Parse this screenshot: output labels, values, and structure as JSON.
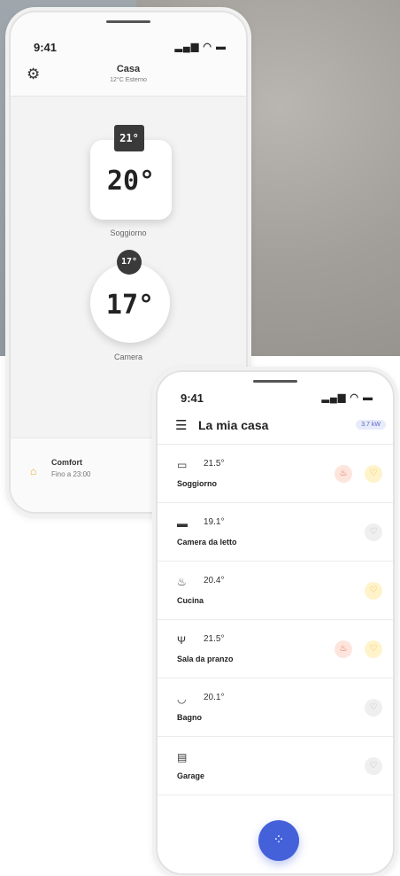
{
  "phone1": {
    "status": {
      "time": "9:41",
      "icons": "▂▄▆ ◠ ▬"
    },
    "header": {
      "title": "Casa",
      "subtitle": "12°C Esterno",
      "settings_icon": "gear-icon"
    },
    "thermostats": [
      {
        "room": "Soggiorno",
        "setpoint": "21°",
        "temperature": "20°",
        "shape": "square"
      },
      {
        "room": "Camera",
        "setpoint": "17°",
        "temperature": "17°",
        "shape": "round"
      }
    ],
    "footer": {
      "mode": "Comfort",
      "until": "Fino a 23:00",
      "icon": "home-icon"
    }
  },
  "phone2": {
    "status": {
      "time": "9:41",
      "icons": "▂▄▆ ◠ ▬"
    },
    "header": {
      "title": "La mia casa",
      "power": "3.7 kW",
      "menu_icon": "hamburger-icon"
    },
    "rooms": [
      {
        "name": "Soggiorno",
        "temp": "21.5°",
        "icon": "sofa-icon",
        "heating": true,
        "light": "on"
      },
      {
        "name": "Camera da letto",
        "temp": "19.1°",
        "icon": "bed-icon",
        "heating": false,
        "light": "off"
      },
      {
        "name": "Cucina",
        "temp": "20.4°",
        "icon": "pot-icon",
        "heating": false,
        "light": "on"
      },
      {
        "name": "Sala da pranzo",
        "temp": "21.5°",
        "icon": "cutlery-icon",
        "heating": true,
        "light": "on"
      },
      {
        "name": "Bagno",
        "temp": "20.1°",
        "icon": "bathtub-icon",
        "heating": false,
        "light": "off"
      },
      {
        "name": "Garage",
        "temp": "",
        "icon": "garage-icon",
        "heating": false,
        "light": "off"
      }
    ],
    "fab_icon": "grid-dots-icon"
  },
  "colors": {
    "accent": "#4561d9",
    "flame": "#e5633a",
    "bulb_on": "#f1b71c",
    "home": "#f5a623"
  }
}
